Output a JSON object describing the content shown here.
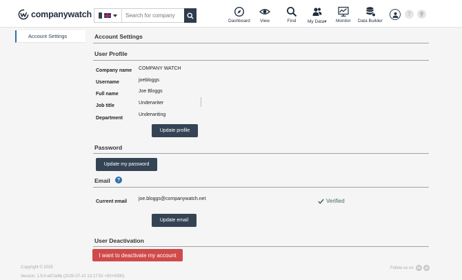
{
  "header": {
    "brand": "companywatch",
    "search": {
      "placeholder": "Search for company",
      "value": ""
    },
    "nav": [
      {
        "label": "Dashboard",
        "icon": "compass-icon"
      },
      {
        "label": "View",
        "icon": "eye-icon"
      },
      {
        "label": "Find",
        "icon": "search-icon"
      },
      {
        "label": "My Data▾",
        "icon": "users-icon"
      },
      {
        "label": "Monitor",
        "icon": "monitor-chart-icon"
      },
      {
        "label": "Data Builder",
        "icon": "database-icon"
      }
    ],
    "help_label": "?"
  },
  "sidebar": {
    "items": [
      {
        "label": "Account Settings",
        "active": true
      }
    ]
  },
  "main": {
    "title": "Account Settings",
    "user_profile": {
      "title": "User Profile",
      "fields": [
        {
          "label": "Company name",
          "value": "COMPANY WATCH"
        },
        {
          "label": "Username",
          "value": "joebloggs"
        },
        {
          "label": "Full name",
          "value": "Joe Bloggs"
        },
        {
          "label": "Job title",
          "value": "Underwriter"
        },
        {
          "label": "Department",
          "value": "Underwriting"
        }
      ],
      "button": "Update profile"
    },
    "password": {
      "title": "Password",
      "button": "Update my password"
    },
    "email": {
      "title": "Email",
      "help": "?",
      "label": "Current email",
      "value": "joe.bloggs@companywatch.net",
      "status": "Verified",
      "button": "Update email"
    },
    "deactivation": {
      "title": "User Deactivation",
      "button": "I want to deactivate my account"
    }
  },
  "footer": {
    "copyright": "Copyright © 2025",
    "version": "Version: 1.9.0-e97edfe (2025-07-10 13:17:52 +00+0000)",
    "follow": "Follow us on",
    "social": [
      "in",
      "yt"
    ]
  },
  "colors": {
    "primary_button": "#354454",
    "danger": "#d04a4a",
    "accent": "#2e6fa7",
    "verified": "#3d6b5a"
  }
}
